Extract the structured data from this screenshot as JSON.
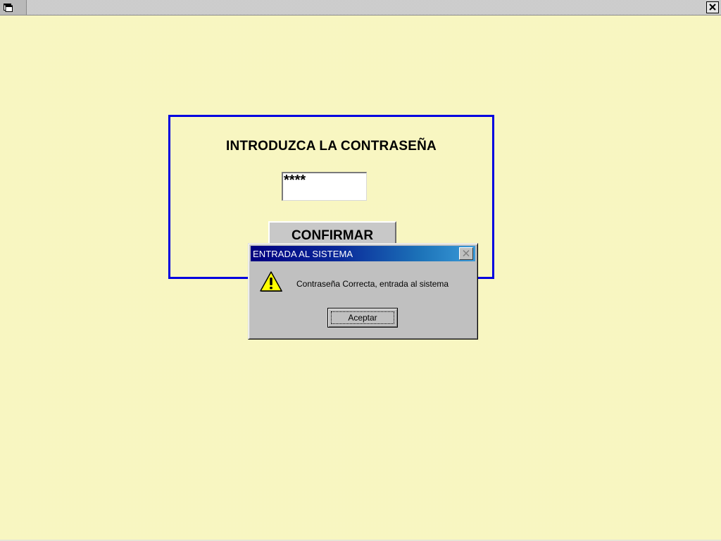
{
  "window": {
    "app_icon": "window-icon",
    "close_icon": "close-icon"
  },
  "login_form": {
    "prompt": "INTRODUZCA LA CONTRASEÑA",
    "password_value": "****",
    "confirm_label": "CONFIRMAR",
    "frame_color": "#0000e0"
  },
  "message_box": {
    "title": "ENTRADA AL SISTEMA",
    "icon": "warning-icon",
    "message": "Contraseña Correcta, entrada al sistema",
    "ok_label": "Aceptar",
    "close_icon": "close-icon"
  },
  "colors": {
    "background": "#fdfcc6",
    "dialog_title_start": "#000080",
    "dialog_title_end": "#3a9ad8",
    "dialog_face": "#c0c0c0"
  }
}
